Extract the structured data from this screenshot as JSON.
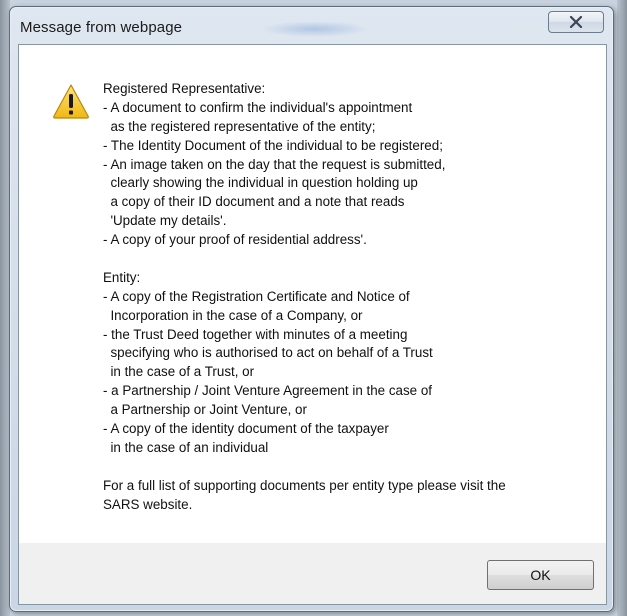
{
  "window": {
    "title": "Message from webpage",
    "close_icon": "close-x-icon"
  },
  "icon": {
    "name": "warning-triangle-icon",
    "color_fill": "#f4c430",
    "color_mark": "#1a1a1a"
  },
  "message": {
    "lines": [
      "Registered Representative:",
      "- A document to confirm the individual's appointment",
      "  as the registered representative of the entity;",
      "- The Identity Document of the individual to be registered;",
      "- An image taken on the day that the request is submitted,",
      "  clearly showing the individual in question holding up",
      "  a copy of their ID document and a note that reads",
      "  'Update my details'.",
      "- A copy of your proof of residential address'.",
      "",
      "Entity:",
      "- A copy of the Registration Certificate and Notice of",
      "  Incorporation in the case of a Company, or",
      "- the Trust Deed together with minutes of a meeting",
      "  specifying who is authorised to act on behalf of a Trust",
      "  in the case of a Trust, or",
      "- a Partnership / Joint Venture Agreement in the case of",
      "  a Partnership or Joint Venture, or",
      "- A copy of the identity document of the taxpayer",
      "  in the case of an individual",
      "",
      "For a full list of supporting documents per entity type please visit the",
      "SARS website."
    ]
  },
  "buttons": {
    "ok_label": "OK"
  }
}
